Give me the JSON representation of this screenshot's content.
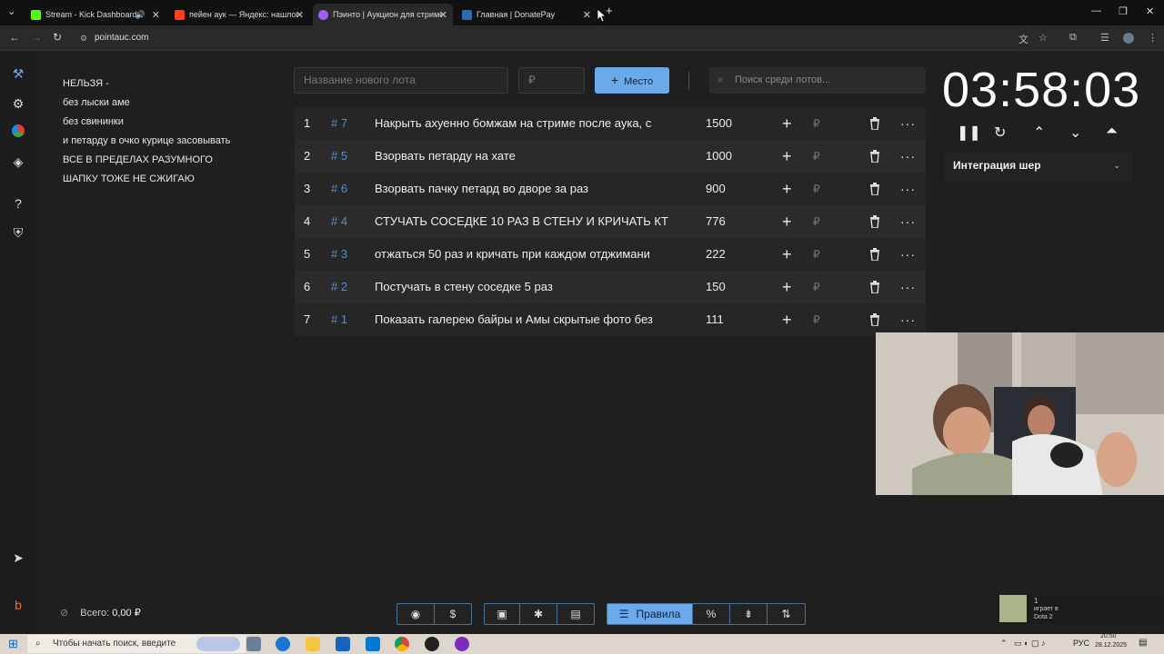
{
  "browser": {
    "tabs": [
      {
        "title": "Stream - Kick Dashboard",
        "color": "#53fc18"
      },
      {
        "title": "пейен аук — Яндекс: нашлось",
        "color": "#fc3f1d"
      },
      {
        "title": "Пэинто | Аукцион для стримеров",
        "color": "#a35bf3"
      },
      {
        "title": "Главная | DonatePay",
        "color": "#2b6cb0"
      }
    ],
    "new_tab": "+",
    "url": "pointauc.com"
  },
  "rules_text": [
    "НЕЛЬЗЯ -",
    "без лыски аме",
    "без свининки",
    "и петарду в очко курице засовывать",
    "ВСЕ В ПРЕДЕЛАХ РАЗУМНОГО",
    "ШАПКУ ТОЖЕ НЕ СЖИГАЮ"
  ],
  "controls": {
    "new_lot_placeholder": "Название нового лота",
    "amount_placeholder": "₽",
    "place_button": "Место",
    "search_placeholder": "Поиск среди лотов..."
  },
  "lots": [
    {
      "num": "1",
      "id": "# 7",
      "name": "Накрыть ахуенно бомжам на стриме после аука, с",
      "amount": "1500"
    },
    {
      "num": "2",
      "id": "# 5",
      "name": "Взорвать петарду на хате",
      "amount": "1000"
    },
    {
      "num": "3",
      "id": "# 6",
      "name": "Взорвать пачку петард во дворе за раз",
      "amount": "900"
    },
    {
      "num": "4",
      "id": "# 4",
      "name": "СТУЧАТЬ СОСЕДКЕ 10 РАЗ В СТЕНУ И КРИЧАТЬ КТ",
      "amount": "776"
    },
    {
      "num": "5",
      "id": "# 3",
      "name": "отжаться 50 раз и кричать при каждом отджимани",
      "amount": "222"
    },
    {
      "num": "6",
      "id": "# 2",
      "name": "Постучать в стену соседке 5 раз",
      "amount": "150"
    },
    {
      "num": "7",
      "id": "# 1",
      "name": "Показать галерею байры и Амы скрытые фото без",
      "amount": "111"
    }
  ],
  "row_symbols": {
    "plus": "+",
    "rub": "₽",
    "more": "···"
  },
  "timer": "03:58:03",
  "integration": {
    "label": "Интеграция шер"
  },
  "footer": {
    "total_label": "Всего:",
    "total_value": "0,00 ₽"
  },
  "toolbar": {
    "rules_label": "Правила",
    "percent": "%"
  },
  "notification": {
    "count": "1",
    "line1": "играет в",
    "game": "Dota 2"
  },
  "taskbar": {
    "search_placeholder": "Чтобы начать поиск, введите",
    "lang": "РУС",
    "time": "20:50",
    "date": "28.12.2025"
  },
  "colors": {
    "accent": "#6aa9ea",
    "lot_id": "#4e8fd6",
    "background": "#1f1f1f"
  }
}
